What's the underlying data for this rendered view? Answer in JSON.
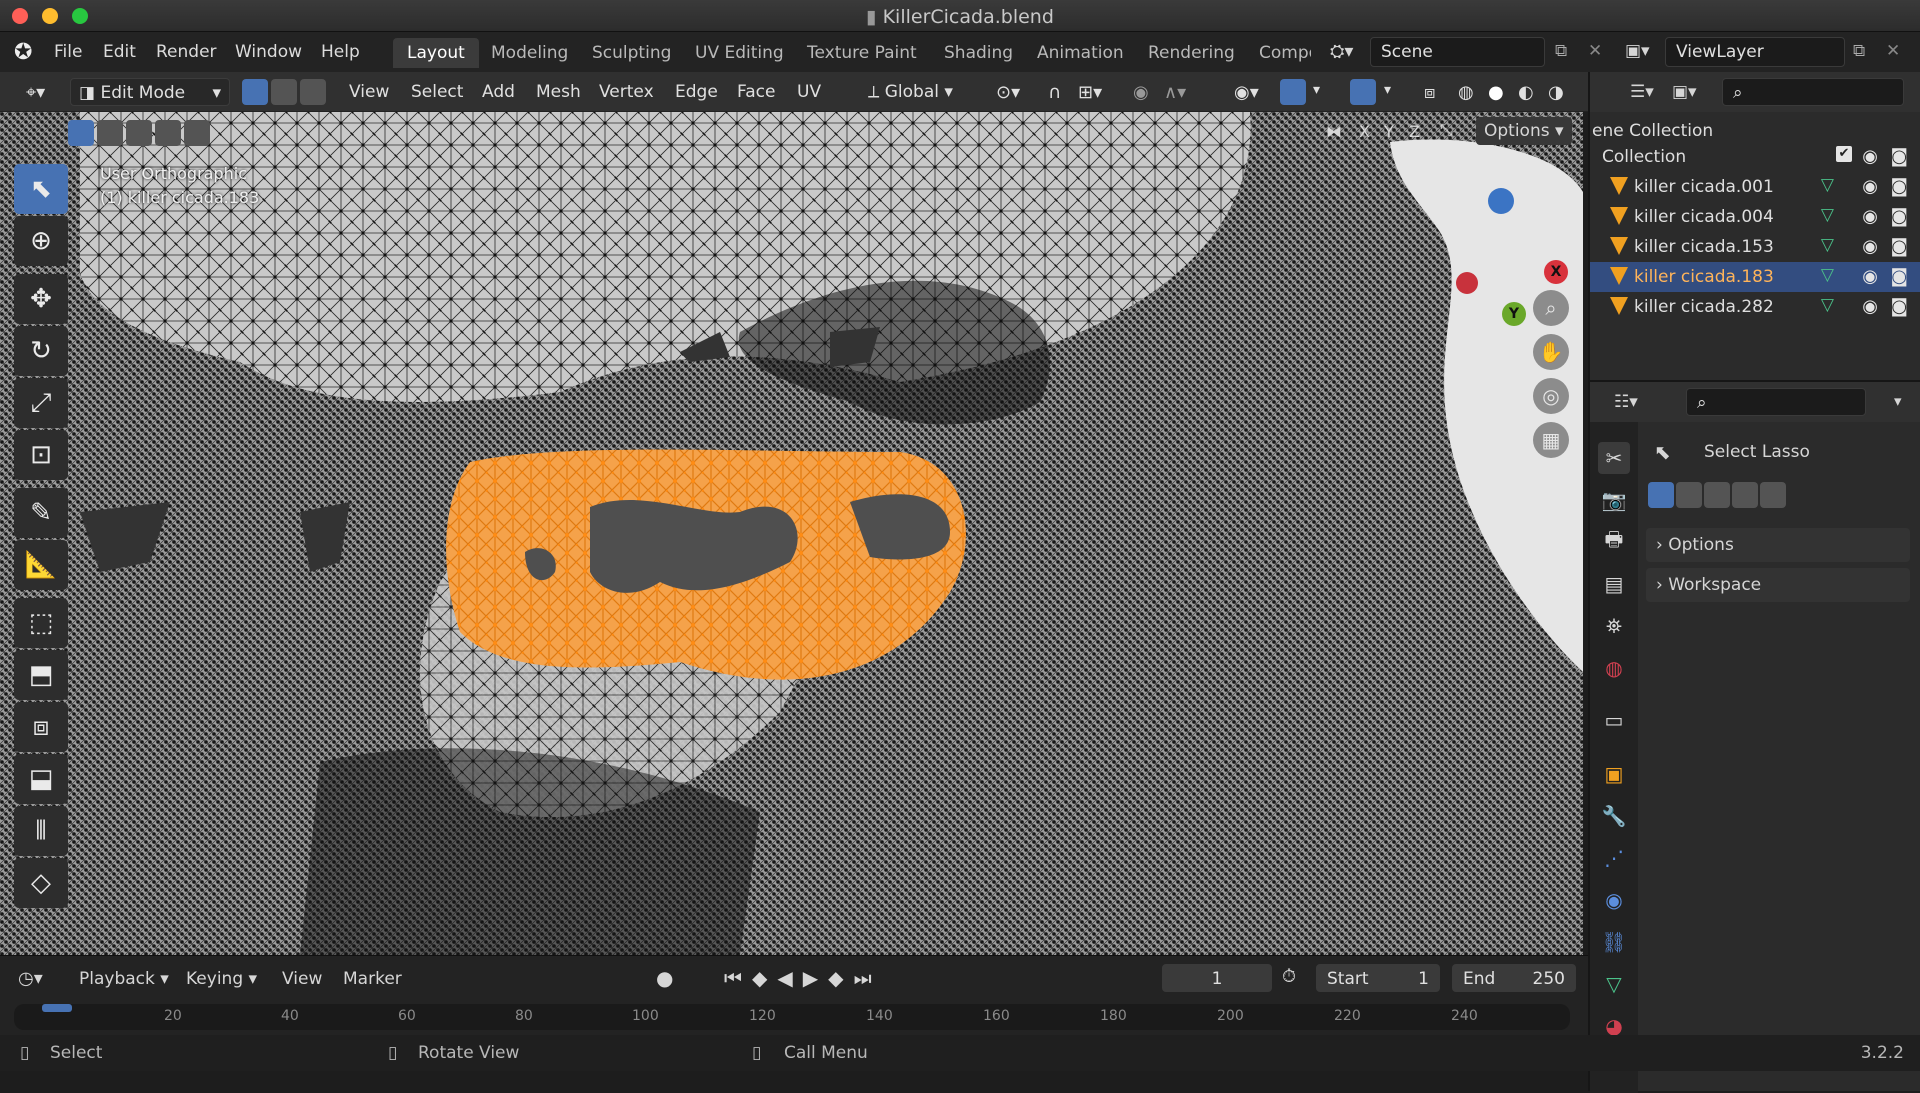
{
  "window": {
    "title": "KillerCicada.blend"
  },
  "topmenu": {
    "items": [
      "File",
      "Edit",
      "Render",
      "Window",
      "Help"
    ]
  },
  "workspaces": [
    "Layout",
    "Modeling",
    "Sculpting",
    "UV Editing",
    "Texture Paint",
    "Shading",
    "Animation",
    "Rendering",
    "Compo"
  ],
  "scene": {
    "name": "Scene"
  },
  "viewlayer": {
    "name": "ViewLayer"
  },
  "header": {
    "mode": "Edit Mode",
    "menus": [
      "View",
      "Select",
      "Add",
      "Mesh",
      "Vertex",
      "Edge",
      "Face",
      "UV"
    ],
    "orientation": "Global",
    "axes": [
      "X",
      "Y",
      "Z"
    ],
    "options": "Options"
  },
  "viewport": {
    "view_label": "User Orthographic",
    "object_label": "(1) killer cicada.183",
    "gizmo": {
      "x": "X",
      "y": "Y"
    },
    "selection_color": "#f28c1e"
  },
  "outliner": {
    "scene_collection": "ene Collection",
    "collection": "Collection",
    "items": [
      {
        "name": "killer cicada.001",
        "selected": false
      },
      {
        "name": "killer cicada.004",
        "selected": false
      },
      {
        "name": "killer cicada.153",
        "selected": false
      },
      {
        "name": "killer cicada.183",
        "selected": true
      },
      {
        "name": "killer cicada.282",
        "selected": false
      }
    ]
  },
  "properties": {
    "tool_name": "Select Lasso",
    "sections": [
      "Options",
      "Workspace"
    ]
  },
  "timeline": {
    "menus": [
      "Playback",
      "Keying",
      "View",
      "Marker"
    ],
    "current_frame": "1",
    "start_label": "Start",
    "start": "1",
    "end_label": "End",
    "end": "250",
    "ticks": [
      "20",
      "40",
      "60",
      "80",
      "100",
      "120",
      "140",
      "160",
      "180",
      "200",
      "220",
      "240"
    ]
  },
  "statusbar": {
    "items": [
      "Select",
      "Rotate View",
      "Call Menu"
    ],
    "version": "3.2.2"
  },
  "colors": {
    "accent": "#4772b3",
    "selected_row": "#334d80",
    "mesh_icon": "#f0a020"
  }
}
